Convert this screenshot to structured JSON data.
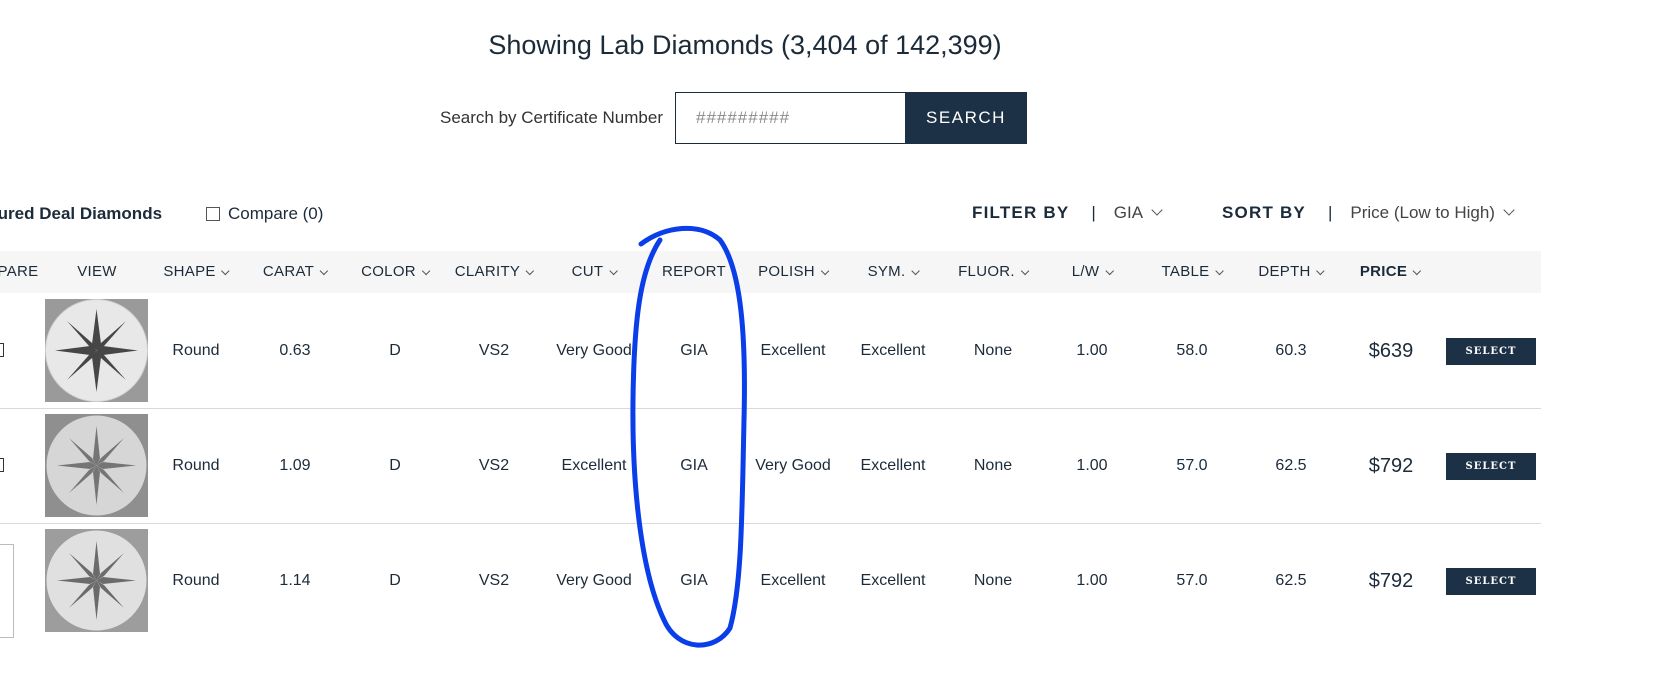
{
  "heading": "Showing Lab Diamonds (3,404 of 142,399)",
  "search": {
    "label": "Search by Certificate Number",
    "placeholder": "#########",
    "button": "SEARCH"
  },
  "toolbar": {
    "featured": "tured Deal Diamonds",
    "compare": "Compare (0)",
    "filter_label": "FILTER BY",
    "filter_value": "GIA",
    "sort_label": "SORT BY",
    "sort_value": "Price (Low to High)",
    "separator": "|"
  },
  "columns": [
    {
      "label": "PARE",
      "sortable": false
    },
    {
      "label": "VIEW",
      "sortable": false
    },
    {
      "label": "SHAPE",
      "sortable": true
    },
    {
      "label": "CARAT",
      "sortable": true
    },
    {
      "label": "COLOR",
      "sortable": true
    },
    {
      "label": "CLARITY",
      "sortable": true
    },
    {
      "label": "CUT",
      "sortable": true
    },
    {
      "label": "REPORT",
      "sortable": false
    },
    {
      "label": "POLISH",
      "sortable": true
    },
    {
      "label": "SYM.",
      "sortable": true
    },
    {
      "label": "FLUOR.",
      "sortable": true
    },
    {
      "label": "L/W",
      "sortable": true
    },
    {
      "label": "TABLE",
      "sortable": true
    },
    {
      "label": "DEPTH",
      "sortable": true
    },
    {
      "label": "PRICE",
      "sortable": true
    }
  ],
  "rows": [
    {
      "shape": "Round",
      "carat": "0.63",
      "color": "D",
      "clarity": "VS2",
      "cut": "Very Good",
      "report": "GIA",
      "polish": "Excellent",
      "sym": "Excellent",
      "fluor": "None",
      "lw": "1.00",
      "table": "58.0",
      "depth": "60.3",
      "price": "$639",
      "action": "SELECT"
    },
    {
      "shape": "Round",
      "carat": "1.09",
      "color": "D",
      "clarity": "VS2",
      "cut": "Excellent",
      "report": "GIA",
      "polish": "Very Good",
      "sym": "Excellent",
      "fluor": "None",
      "lw": "1.00",
      "table": "57.0",
      "depth": "62.5",
      "price": "$792",
      "action": "SELECT"
    },
    {
      "shape": "Round",
      "carat": "1.14",
      "color": "D",
      "clarity": "VS2",
      "cut": "Very Good",
      "report": "GIA",
      "polish": "Excellent",
      "sym": "Excellent",
      "fluor": "None",
      "lw": "1.00",
      "table": "57.0",
      "depth": "62.5",
      "price": "$792",
      "action": "SELECT"
    }
  ],
  "colors": {
    "navy": "#1c3145",
    "header_bg": "#f6f6f6",
    "annotation": "#0a3ee8"
  }
}
